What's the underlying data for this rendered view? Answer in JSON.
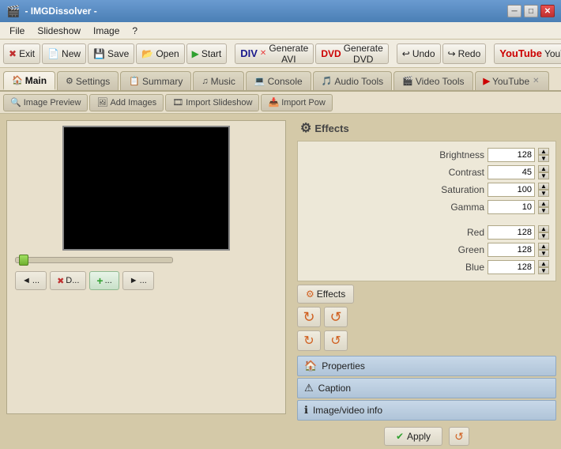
{
  "titlebar": {
    "title": "- IMGDissolver -",
    "icon": "■"
  },
  "menubar": {
    "items": [
      "File",
      "Slideshow",
      "Image",
      "?"
    ]
  },
  "toolbar": {
    "buttons": [
      {
        "id": "exit",
        "label": "Exit",
        "icon": "✖"
      },
      {
        "id": "new",
        "label": "New",
        "icon": "📄"
      },
      {
        "id": "save",
        "label": "Save",
        "icon": "💾"
      },
      {
        "id": "open",
        "label": "Open",
        "icon": "📂"
      },
      {
        "id": "start",
        "label": "Start",
        "icon": "▶"
      },
      {
        "id": "generate-avi",
        "label": "Generate AVI",
        "icon": "DIV"
      },
      {
        "id": "generate-dvd",
        "label": "Generate DVD",
        "icon": "DVD"
      },
      {
        "id": "undo",
        "label": "Undo",
        "icon": "↩"
      },
      {
        "id": "redo",
        "label": "Redo",
        "icon": "↪"
      },
      {
        "id": "youtube",
        "label": "YouTube",
        "icon": "▶"
      }
    ]
  },
  "tabs": [
    {
      "id": "main",
      "label": "Main",
      "active": true,
      "closable": false,
      "icon": "🏠"
    },
    {
      "id": "settings",
      "label": "Settings",
      "active": false,
      "closable": false,
      "icon": "⚙"
    },
    {
      "id": "summary",
      "label": "Summary",
      "active": false,
      "closable": false,
      "icon": "📋"
    },
    {
      "id": "music",
      "label": "Music",
      "active": false,
      "closable": false,
      "icon": "♫"
    },
    {
      "id": "console",
      "label": "Console",
      "active": false,
      "closable": false,
      "icon": "💻"
    },
    {
      "id": "audio-tools",
      "label": "Audio Tools",
      "active": false,
      "closable": false,
      "icon": "🎵"
    },
    {
      "id": "video-tools",
      "label": "Video Tools",
      "active": false,
      "closable": false,
      "icon": "🎬"
    },
    {
      "id": "youtube-tab",
      "label": "YouTube",
      "active": false,
      "closable": true,
      "icon": "▶"
    }
  ],
  "subtabs": [
    {
      "id": "image-preview",
      "label": "Image Preview",
      "icon": "🔍"
    },
    {
      "id": "add-images",
      "label": "Add Images",
      "icon": "🖼"
    },
    {
      "id": "import-slideshow",
      "label": "Import Slideshow",
      "icon": "🎞"
    },
    {
      "id": "import-pow",
      "label": "Import Pow",
      "icon": "📥"
    }
  ],
  "effects_panel": {
    "title": "Effects",
    "sliders": [
      {
        "label": "Brightness",
        "value": "128"
      },
      {
        "label": "Contrast",
        "value": "45"
      },
      {
        "label": "Saturation",
        "value": "100"
      },
      {
        "label": "Gamma",
        "value": "10"
      }
    ],
    "color_sliders": [
      {
        "label": "Red",
        "value": "128"
      },
      {
        "label": "Green",
        "value": "128"
      },
      {
        "label": "Blue",
        "value": "128"
      }
    ],
    "effects_button": "Effects",
    "properties_items": [
      {
        "id": "properties",
        "label": "Properties",
        "icon": "🏠"
      },
      {
        "id": "caption",
        "label": "Caption",
        "icon": "⚠"
      },
      {
        "id": "image-video-info",
        "label": "Image/video info",
        "icon": "ℹ"
      }
    ],
    "apply_label": "Apply"
  },
  "bottom_controls": [
    {
      "id": "prev",
      "label": "◄ ...",
      "icon": "◄"
    },
    {
      "id": "delete",
      "label": "✖ D...",
      "icon": "✖"
    },
    {
      "id": "add",
      "label": "+ ...",
      "icon": "+"
    },
    {
      "id": "next",
      "label": "► ...",
      "icon": "►"
    }
  ]
}
